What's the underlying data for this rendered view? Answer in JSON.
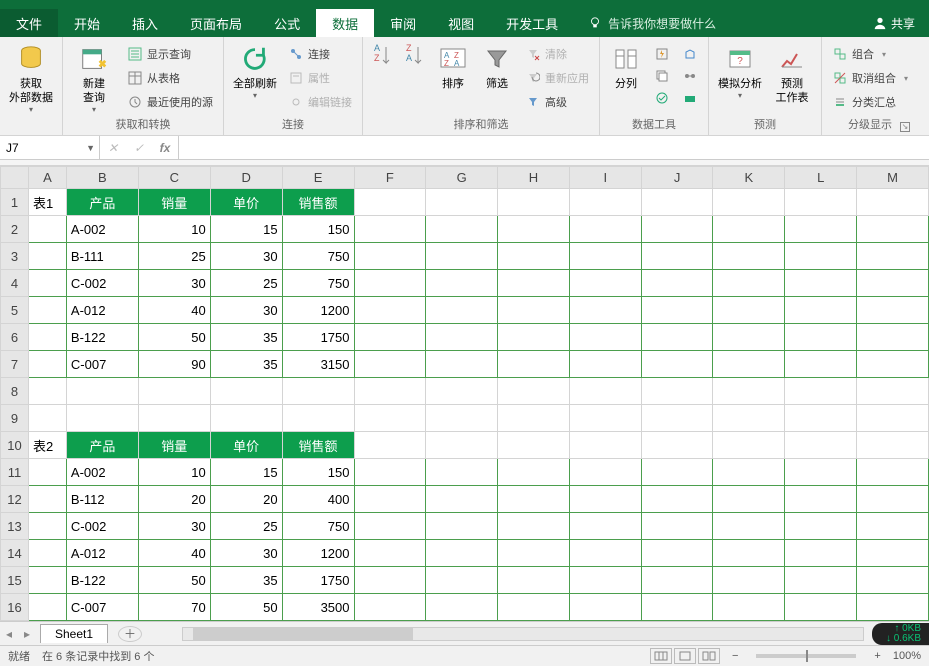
{
  "app": {
    "share": "共享"
  },
  "tabs": {
    "file": "文件",
    "home": "开始",
    "insert": "插入",
    "layout": "页面布局",
    "formulas": "公式",
    "data": "数据",
    "review": "审阅",
    "view": "视图",
    "dev": "开发工具",
    "tellme": "告诉我你想要做什么"
  },
  "ribbon": {
    "external": {
      "label": "获取\n外部数据"
    },
    "newquery": {
      "label": "新建\n查询"
    },
    "getTransform": {
      "show": "显示查询",
      "fromtable": "从表格",
      "recent": "最近使用的源",
      "group": "获取和转换"
    },
    "refresh": {
      "label": "全部刷新"
    },
    "connections": {
      "conn": "连接",
      "prop": "属性",
      "edit": "编辑链接",
      "group": "连接"
    },
    "sortfilter": {
      "sort": "排序",
      "filter": "筛选",
      "clear": "清除",
      "reapply": "重新应用",
      "advanced": "高级",
      "group": "排序和筛选"
    },
    "datatools": {
      "ttc": "分列",
      "group": "数据工具"
    },
    "forecast": {
      "whatif": "模拟分析",
      "fs": "预测\n工作表",
      "group": "预测"
    },
    "outline": {
      "grp": "组合",
      "ungrp": "取消组合",
      "subtotal": "分类汇总",
      "group": "分级显示"
    }
  },
  "namebox": "J7",
  "sheet": {
    "cols": [
      "A",
      "B",
      "C",
      "D",
      "E",
      "F",
      "G",
      "H",
      "I",
      "J",
      "K",
      "L",
      "M"
    ],
    "labels": {
      "t1": "表1",
      "t2": "表2"
    },
    "headers": {
      "prod": "产品",
      "qty": "销量",
      "price": "单价",
      "sales": "销售额"
    },
    "table1": [
      {
        "p": "A-002",
        "q": 10,
        "u": 15,
        "s": 150
      },
      {
        "p": "B-111",
        "q": 25,
        "u": 30,
        "s": 750
      },
      {
        "p": "C-002",
        "q": 30,
        "u": 25,
        "s": 750
      },
      {
        "p": "A-012",
        "q": 40,
        "u": 30,
        "s": 1200
      },
      {
        "p": "B-122",
        "q": 50,
        "u": 35,
        "s": 1750
      },
      {
        "p": "C-007",
        "q": 90,
        "u": 35,
        "s": 3150
      }
    ],
    "table2": [
      {
        "p": "A-002",
        "q": 10,
        "u": 15,
        "s": 150
      },
      {
        "p": "B-112",
        "q": 20,
        "u": 20,
        "s": 400
      },
      {
        "p": "C-002",
        "q": 30,
        "u": 25,
        "s": 750
      },
      {
        "p": "A-012",
        "q": 40,
        "u": 30,
        "s": 1200
      },
      {
        "p": "B-122",
        "q": 50,
        "u": 35,
        "s": 1750
      },
      {
        "p": "C-007",
        "q": 70,
        "u": 50,
        "s": 3500
      }
    ]
  },
  "sheettab": "Sheet1",
  "status": {
    "ready": "就绪",
    "found": "在 6 条记录中找到 6 个",
    "zoom": "100%",
    "net_up": "0KB",
    "net_dn": "0.6KB"
  }
}
